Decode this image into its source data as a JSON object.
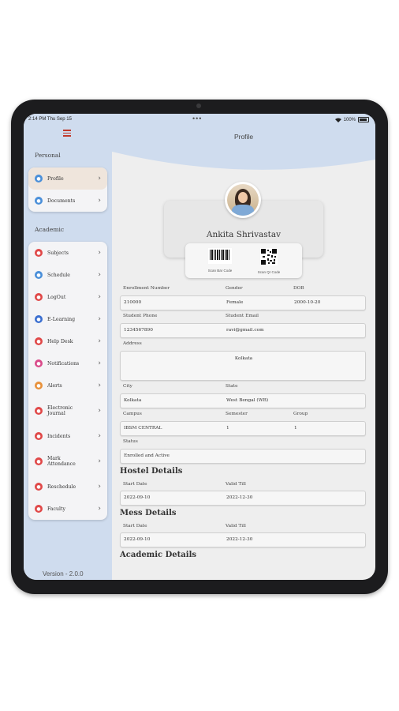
{
  "status_bar": {
    "time": "2:14 PM   Thu Sep 15",
    "dots": "•••",
    "battery": "100%"
  },
  "header": {
    "title": "Profile"
  },
  "sidebar": {
    "personal_label": "Personal",
    "academic_label": "Academic",
    "personal_items": [
      {
        "label": "Profile",
        "icon": "profile-icon",
        "color": "#4a8fd9"
      },
      {
        "label": "Documents",
        "icon": "documents-icon",
        "color": "#4a8fd9"
      }
    ],
    "academic_items": [
      {
        "label": "Subjects",
        "icon": "subjects-icon",
        "color": "#e04848"
      },
      {
        "label": "Schedule",
        "icon": "schedule-icon",
        "color": "#4a8fd9"
      },
      {
        "label": "LogOut",
        "icon": "logout-icon",
        "color": "#e04848"
      },
      {
        "label": "E-Learning",
        "icon": "elearning-icon",
        "color": "#3b6fd0"
      },
      {
        "label": "Help Desk",
        "icon": "helpdesk-icon",
        "color": "#e04848"
      },
      {
        "label": "Notifications",
        "icon": "notifications-icon",
        "color": "#d94a8a"
      },
      {
        "label": "Alerts",
        "icon": "alerts-icon",
        "color": "#e8913b"
      },
      {
        "label": "Electronic Journal",
        "icon": "journal-icon",
        "color": "#e04848"
      },
      {
        "label": "Incidents",
        "icon": "incidents-icon",
        "color": "#e04848"
      },
      {
        "label": "Mark Attendance",
        "icon": "attendance-icon",
        "color": "#e04848"
      },
      {
        "label": "Reschedule",
        "icon": "reschedule-icon",
        "color": "#e04848"
      },
      {
        "label": "Faculty",
        "icon": "faculty-icon",
        "color": "#e04848"
      }
    ],
    "version": "Version - 2.0.0"
  },
  "profile": {
    "name": "Ankita Shrivastav",
    "bar_code_caption": "Scan Bar Code",
    "qr_code_caption": "Scan Qr Code"
  },
  "fields": {
    "enrollment_label": "Enrollment Number",
    "enrollment": "210000",
    "gender_label": "Gender",
    "gender": "Female",
    "dob_label": "DOB",
    "dob": "2000-10-20",
    "phone_label": "Student Phone",
    "phone": "1234567890",
    "email_label": "Student Email",
    "email": "ravi@gmail.com",
    "address_label": "Address",
    "address": "Kolkata",
    "city_label": "City",
    "city": "Kolkata",
    "state_label": "State",
    "state": "West Bengal (WB)",
    "campus_label": "Campus",
    "campus": "IBSM CENTRAL",
    "semester_label": "Semester",
    "semester": "1",
    "group_label": "Group",
    "group": "1",
    "status_label": "Status",
    "status": "Enrolled and Active"
  },
  "hostel": {
    "title": "Hostel Details",
    "start_label": "Start Date",
    "start": "2022-09-10",
    "valid_label": "Valid Till",
    "valid": "2022-12-30"
  },
  "mess": {
    "title": "Mess Details",
    "start_label": "Start Date",
    "start": "2022-09-10",
    "valid_label": "Valid Till",
    "valid": "2022-12-30"
  },
  "academic": {
    "title": "Academic Details"
  }
}
